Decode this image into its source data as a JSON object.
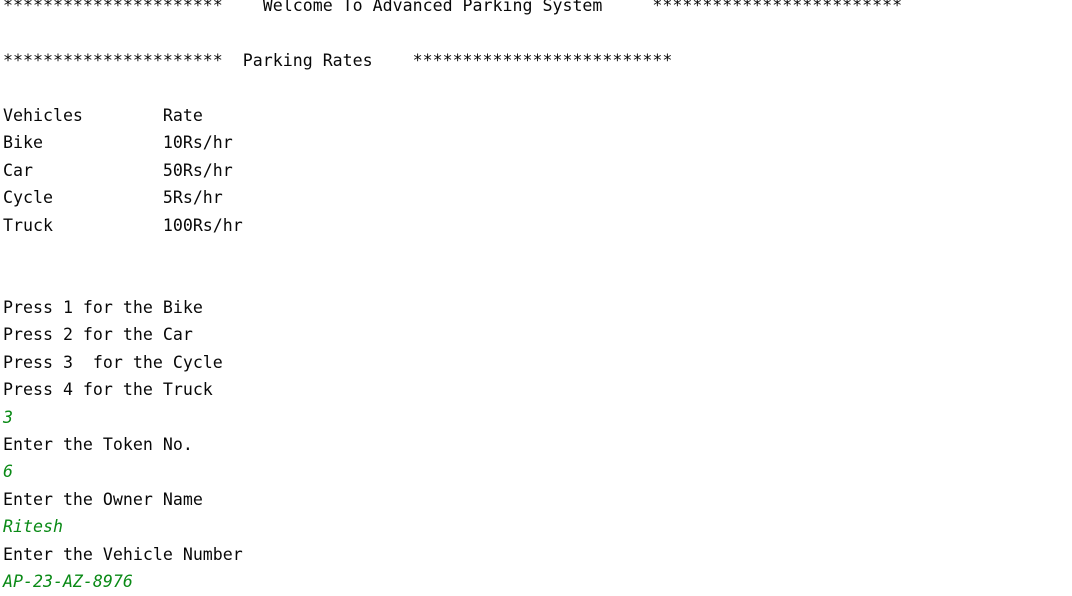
{
  "console": {
    "input_color": "#0a8a16",
    "text_color": "#080808",
    "lines": [
      {
        "type": "output",
        "text": "**********************    Welcome To Advanced Parking System     *************************"
      },
      {
        "type": "output",
        "text": ""
      },
      {
        "type": "output",
        "text": "**********************  Parking Rates    **************************"
      },
      {
        "type": "output",
        "text": ""
      },
      {
        "type": "output",
        "text": "Vehicles        Rate"
      },
      {
        "type": "output",
        "text": "Bike            10Rs/hr"
      },
      {
        "type": "output",
        "text": "Car             50Rs/hr"
      },
      {
        "type": "output",
        "text": "Cycle           5Rs/hr"
      },
      {
        "type": "output",
        "text": "Truck           100Rs/hr"
      },
      {
        "type": "output",
        "text": ""
      },
      {
        "type": "output",
        "text": ""
      },
      {
        "type": "output",
        "text": "Press 1 for the Bike"
      },
      {
        "type": "output",
        "text": "Press 2 for the Car"
      },
      {
        "type": "output",
        "text": "Press 3  for the Cycle"
      },
      {
        "type": "output",
        "text": "Press 4 for the Truck"
      },
      {
        "type": "input",
        "text": "3"
      },
      {
        "type": "output",
        "text": "Enter the Token No."
      },
      {
        "type": "input",
        "text": "6"
      },
      {
        "type": "output",
        "text": "Enter the Owner Name"
      },
      {
        "type": "input",
        "text": "Ritesh"
      },
      {
        "type": "output",
        "text": "Enter the Vehicle Number"
      },
      {
        "type": "input",
        "text": "AP-23-AZ-8976"
      }
    ]
  }
}
